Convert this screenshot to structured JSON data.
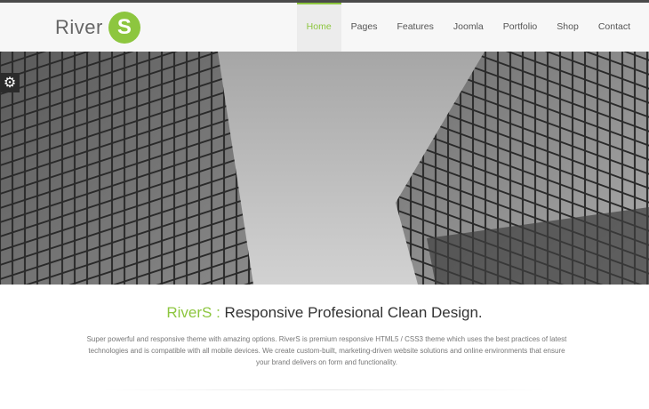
{
  "header": {
    "logo_text": "River",
    "logo_badge": "S"
  },
  "nav": {
    "items": [
      "Home",
      "Pages",
      "Features",
      "Joomla",
      "Portfolio",
      "Shop",
      "Contact"
    ],
    "active_index": 0
  },
  "hero": {
    "settings_icon": "gear-icon"
  },
  "intro": {
    "brand": "RiverS :",
    "headline": " Responsive Profesional Clean Design.",
    "description": "Super powerful and responsive theme with amazing options. RiverS is premium responsive HTML5 / CSS3 theme which uses the best practices of latest technologies and is compatible with all mobile devices. We create custom-built, marketing-driven website solutions and online environments that ensure your brand delivers on form and functionality."
  },
  "colors": {
    "accent": "#8dc63f",
    "text_dark": "#333333",
    "text_muted": "#777777"
  }
}
